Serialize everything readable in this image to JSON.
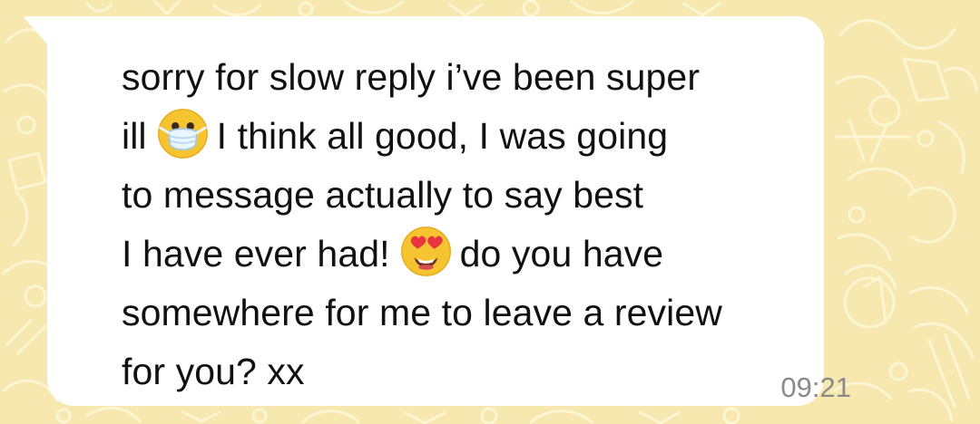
{
  "message": {
    "lines": [
      {
        "before": "sorry for slow reply i’ve been super"
      },
      {
        "before": "ill",
        "emoji": "medical-mask-emoji",
        "after": "I think all good, I was going"
      },
      {
        "before": "to message actually to say best"
      },
      {
        "before": "I have ever had!",
        "emoji": "heart-eyes-emoji",
        "after": "do you have"
      },
      {
        "before": "somewhere for me to leave a review"
      },
      {
        "before": "for you? xx"
      }
    ],
    "timestamp": "09:21"
  },
  "colors": {
    "wallpaper": "#f7e8b0",
    "bubble": "#ffffff",
    "text": "#111111",
    "timestamp": "#8a8a8a"
  }
}
